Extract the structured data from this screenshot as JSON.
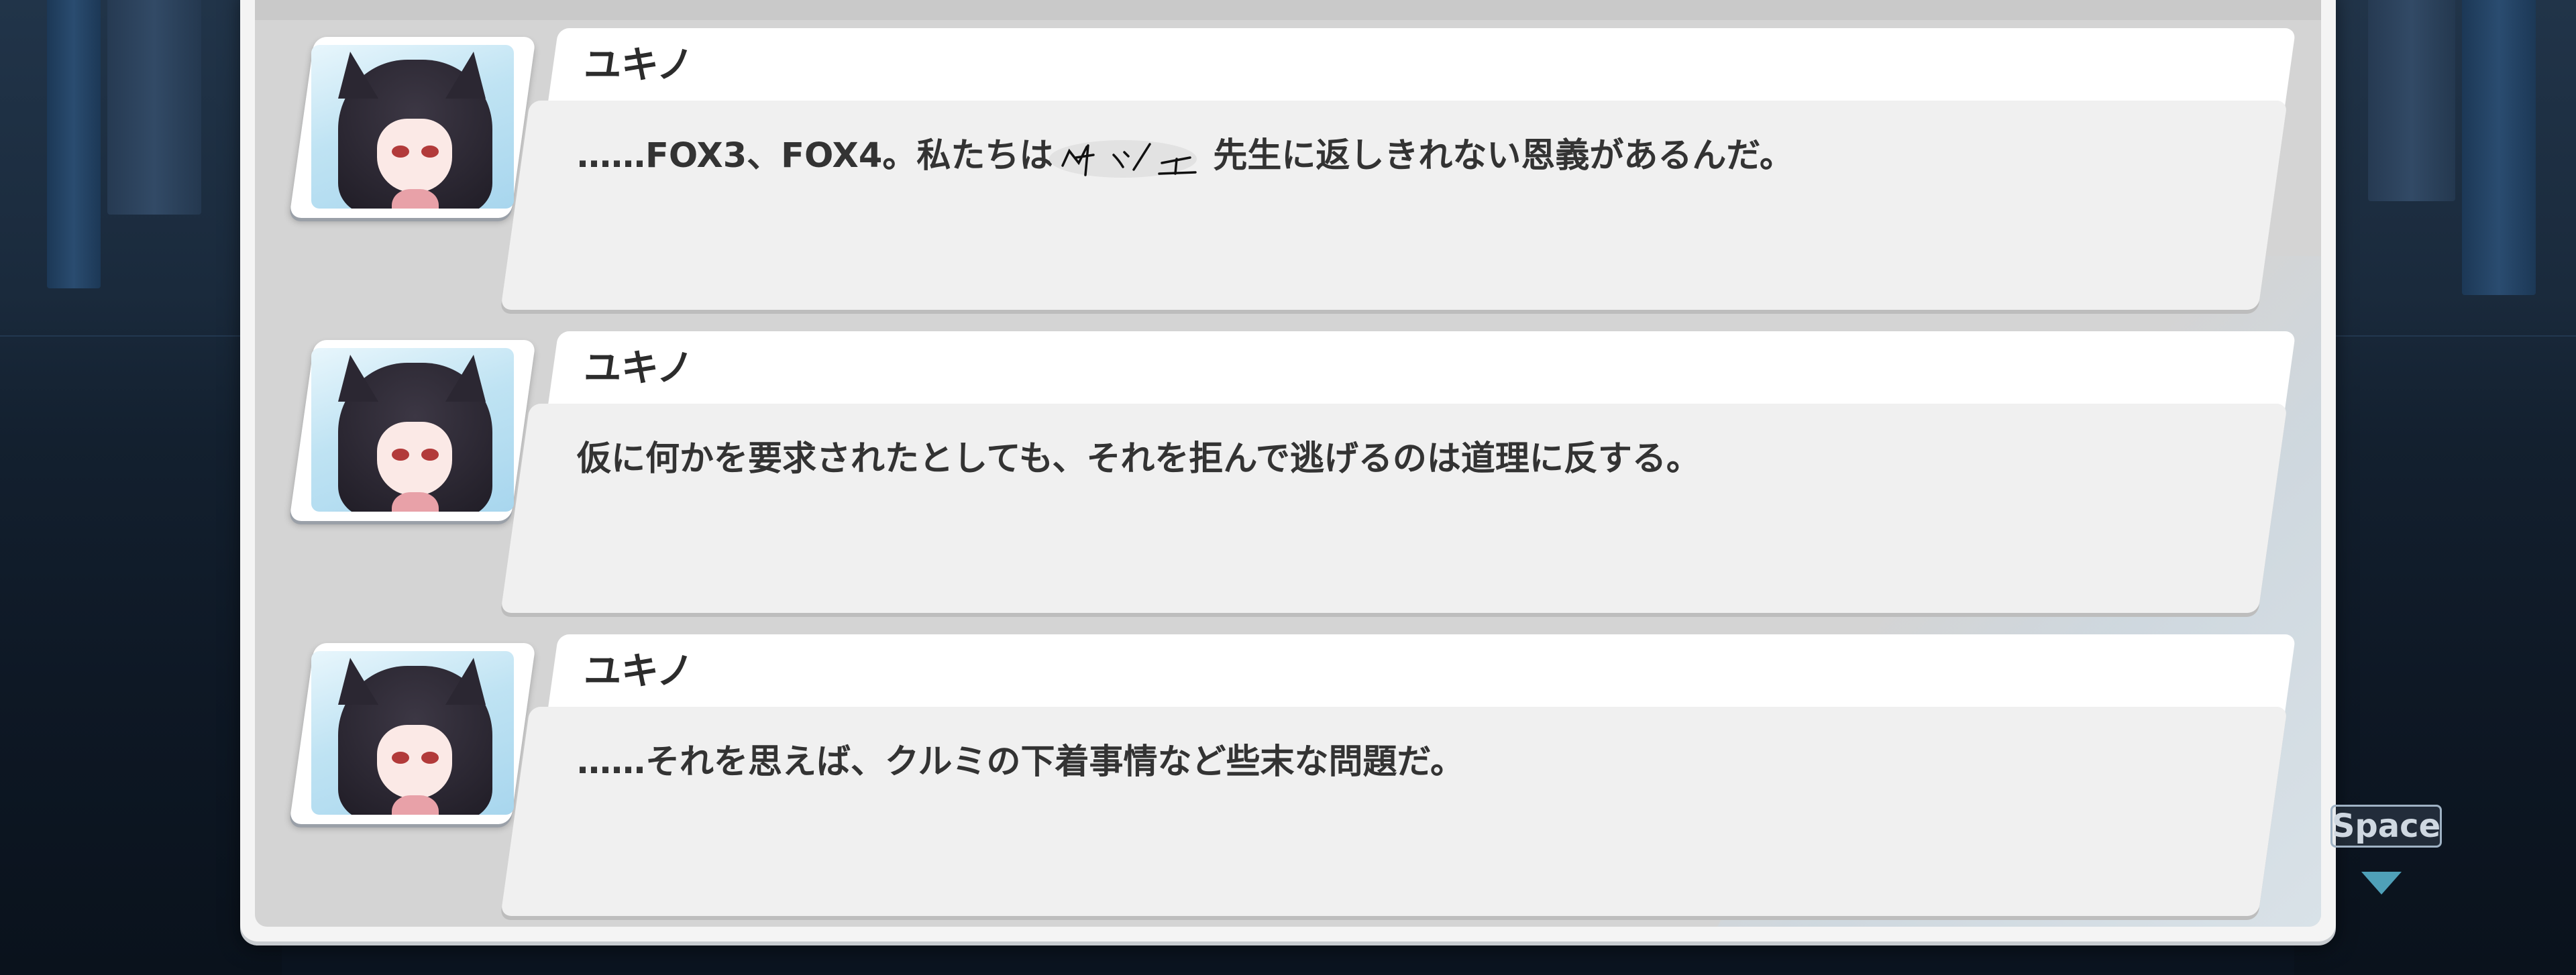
{
  "log": {
    "entries": [
      {
        "speaker": "ユキノ",
        "text_before": "……FOX3、FOX4。私たちは",
        "text_after": "先生に返しきれない恩義があるんだ。"
      },
      {
        "speaker": "ユキノ",
        "text": "仮に何かを要求されたとしても、それを拒んで逃げるのは道理に反する。"
      },
      {
        "speaker": "ユキノ",
        "text": "……それを思えば、クルミの下着事情など些末な問題だ。"
      }
    ]
  },
  "controls": {
    "advance_key_label": "Space",
    "advance_icon": "triangle-down-icon"
  },
  "colors": {
    "accent": "#4fa0b8",
    "panel": "#d4d4d4",
    "bubble": "#f0f0f0"
  }
}
